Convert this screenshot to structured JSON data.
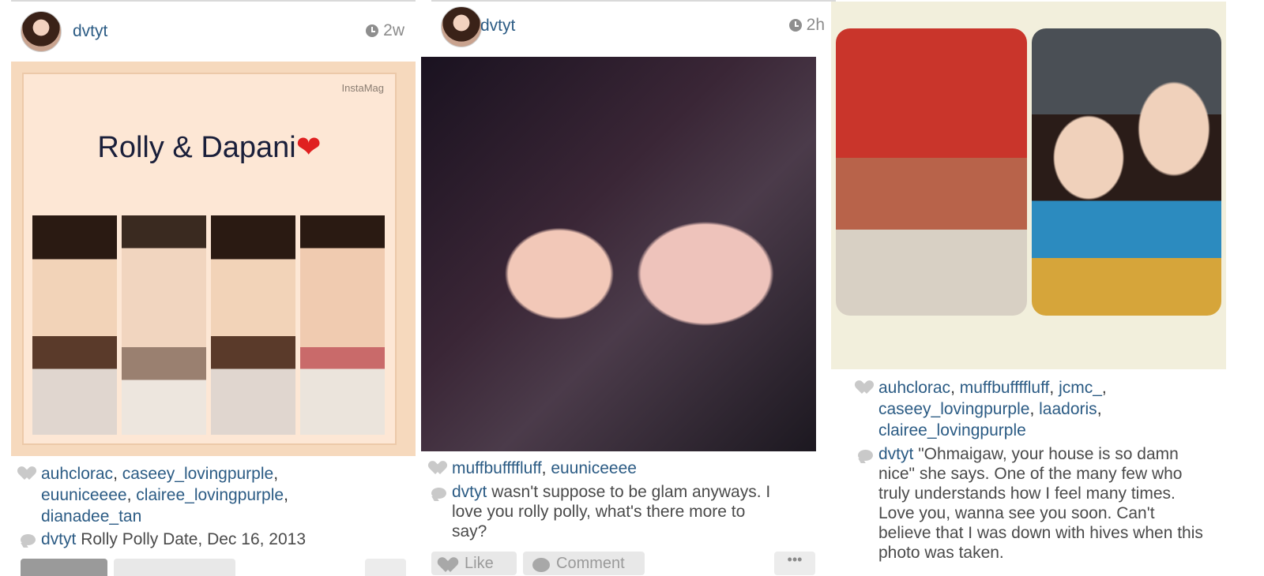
{
  "posts": [
    {
      "username": "dvtyt",
      "time": "2w",
      "photo": {
        "watermark": "InstaMag",
        "title": "Rolly & Dapani",
        "title_emoji": "❤"
      },
      "likes": [
        "auhclorac",
        "caseey_lovingpurple",
        "euuniceeee",
        "clairee_lovingpurple",
        "dianadee_tan"
      ],
      "caption_user": "dvtyt",
      "caption": "Rolly Polly Date, Dec 16, 2013"
    },
    {
      "username": "dvtyt",
      "time": "2h",
      "likes": [
        "muffbuffffluff",
        "euuniceeee"
      ],
      "caption_user": "dvtyt",
      "caption_lines": [
        "wasn't suppose to be glam anyways. I",
        "love you rolly polly, what's there more to",
        "say?"
      ],
      "actions": {
        "like": "Like",
        "comment": "Comment",
        "more": "•••"
      }
    },
    {
      "likes": [
        "auhclorac",
        "muffbuffffluff",
        "jcmc_",
        "caseey_lovingpurple",
        "laadoris",
        "clairee_lovingpurple"
      ],
      "caption_user": "dvtyt",
      "caption_lines": [
        "\"Ohmaigaw, your house is so damn",
        "nice\" she says. One of the many few who",
        "truly understands how I feel many times.",
        "Love you, wanna see you soon. Can't",
        "believe that I was down with hives when this",
        "photo was taken."
      ]
    }
  ],
  "colors": {
    "link": "#2b5b84",
    "muted": "#8c8c8c",
    "heart": "#e02020"
  },
  "icons": [
    "clock-icon",
    "heart-icon",
    "comment-icon",
    "avatar"
  ]
}
